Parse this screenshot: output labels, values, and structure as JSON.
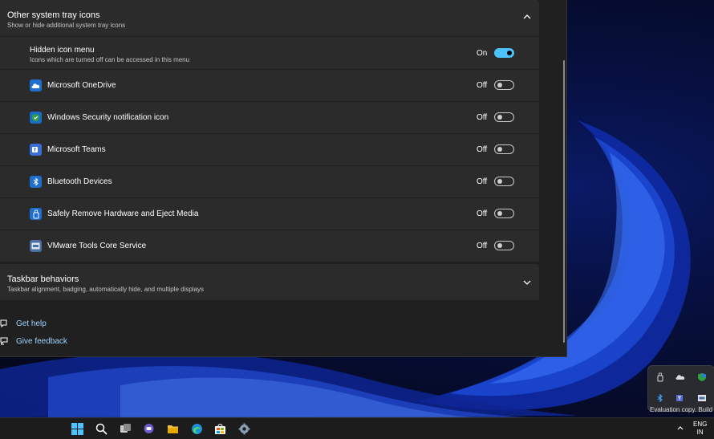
{
  "settings": {
    "tray_group": {
      "title": "Other system tray icons",
      "subtitle": "Show or hide additional system tray icons"
    },
    "hidden_menu": {
      "title": "Hidden icon menu",
      "subtitle": "Icons which are turned off can be accessed in this menu",
      "state": "On"
    },
    "rows": [
      {
        "label": "Microsoft OneDrive",
        "state": "Off"
      },
      {
        "label": "Windows Security notification icon",
        "state": "Off"
      },
      {
        "label": "Microsoft Teams",
        "state": "Off"
      },
      {
        "label": "Bluetooth Devices",
        "state": "Off"
      },
      {
        "label": "Safely Remove Hardware and Eject Media",
        "state": "Off"
      },
      {
        "label": "VMware Tools Core Service",
        "state": "Off"
      }
    ],
    "taskbar_behaviors": {
      "title": "Taskbar behaviors",
      "subtitle": "Taskbar alignment, badging, automatically hide, and multiple displays"
    },
    "links": {
      "help": "Get help",
      "feedback": "Give feedback"
    }
  },
  "desktop": {
    "watermark": "Evaluation copy. Build"
  },
  "taskbar": {
    "lang_line1": "ENG",
    "lang_line2": "IN",
    "icons": [
      "windows-start-icon",
      "search-icon",
      "task-view-icon",
      "chat-icon",
      "file-explorer-icon",
      "edge-icon",
      "store-icon",
      "settings-icon"
    ]
  },
  "colors": {
    "accent": "#4cc2ff",
    "panel": "#2b2b2b",
    "window": "#202020",
    "link": "#9fd3ff"
  }
}
